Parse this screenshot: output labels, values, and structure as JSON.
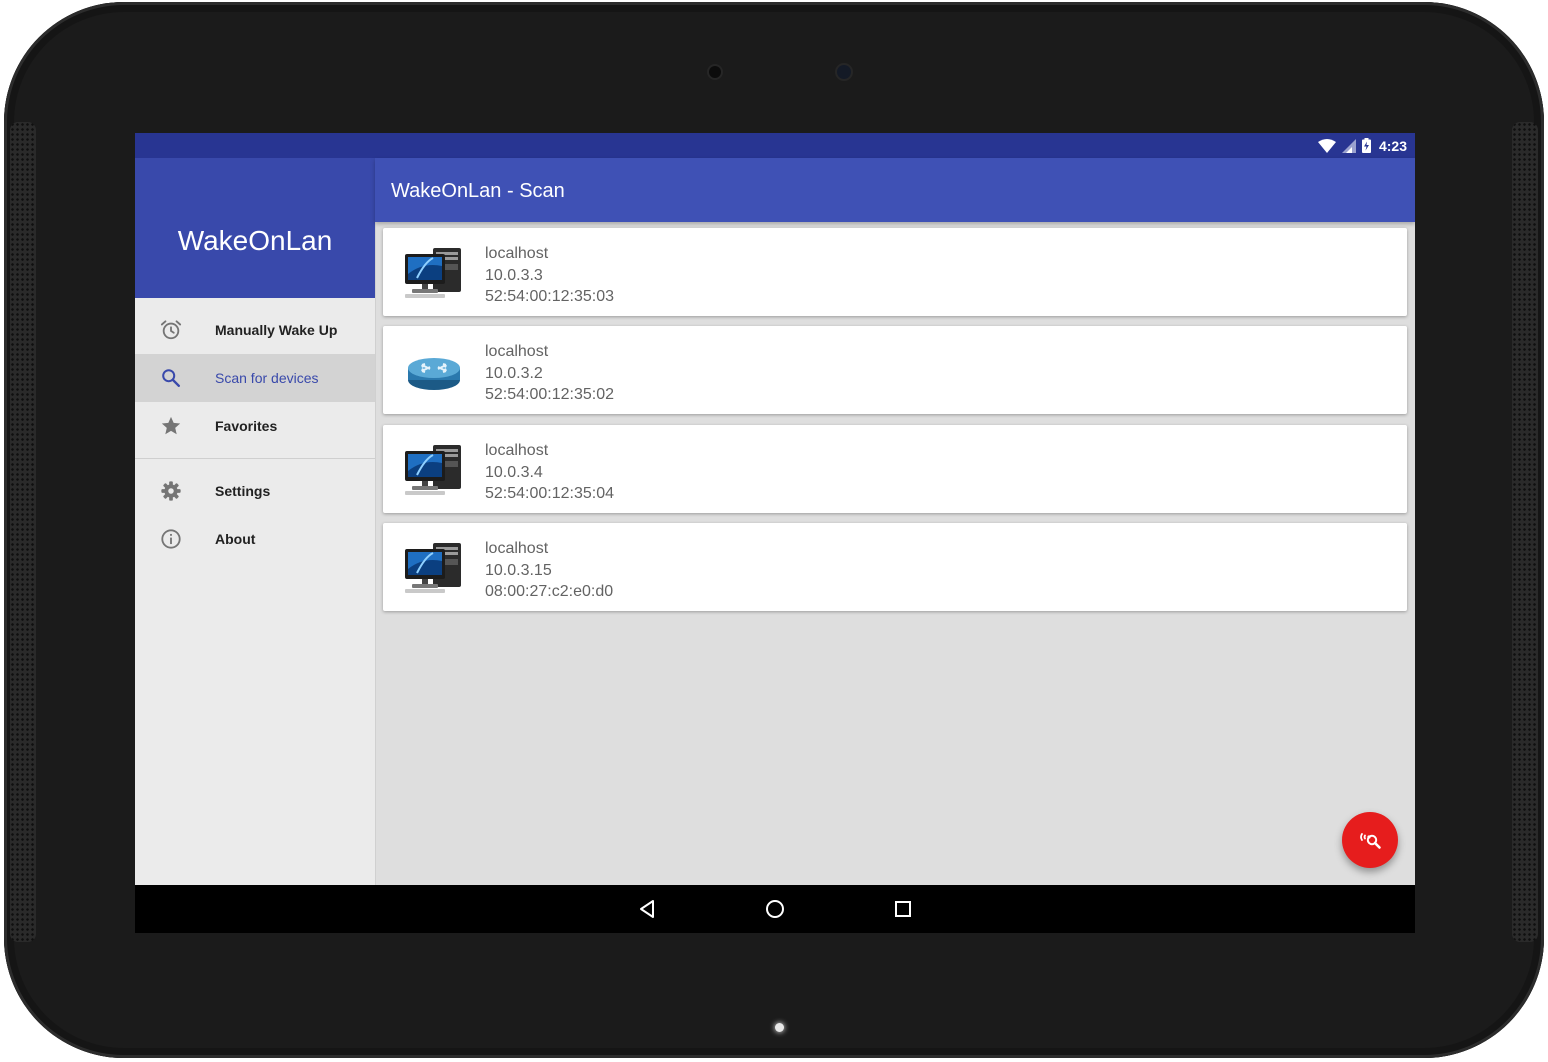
{
  "status_bar": {
    "time": "4:23",
    "icons": [
      "wifi-icon",
      "cell-signal-icon",
      "battery-charging-icon"
    ]
  },
  "app": {
    "drawer_title": "WakeOnLan",
    "toolbar_title": "WakeOnLan - Scan",
    "accent_color": "#3f51b5",
    "fab_color": "#e61d1d"
  },
  "drawer": {
    "items": [
      {
        "label": "Manually Wake Up",
        "icon": "alarm-clock-icon",
        "active": false
      },
      {
        "label": "Scan for devices",
        "icon": "search-icon",
        "active": true
      },
      {
        "label": "Favorites",
        "icon": "star-icon",
        "active": false
      },
      {
        "label": "Settings",
        "icon": "gear-icon",
        "active": false
      },
      {
        "label": "About",
        "icon": "info-icon",
        "active": false
      }
    ]
  },
  "devices": [
    {
      "icon": "computer-icon",
      "hostname": "localhost",
      "ip": "10.0.3.3",
      "mac": "52:54:00:12:35:03"
    },
    {
      "icon": "router-icon",
      "hostname": "localhost",
      "ip": "10.0.3.2",
      "mac": "52:54:00:12:35:02"
    },
    {
      "icon": "computer-icon",
      "hostname": "localhost",
      "ip": "10.0.3.4",
      "mac": "52:54:00:12:35:04"
    },
    {
      "icon": "computer-icon",
      "hostname": "localhost",
      "ip": "10.0.3.15",
      "mac": "08:00:27:c2:e0:d0"
    }
  ],
  "fab": {
    "icon": "wifi-search-icon"
  },
  "nav_bar": {
    "icons": [
      "back-icon",
      "home-icon",
      "recents-icon"
    ]
  }
}
